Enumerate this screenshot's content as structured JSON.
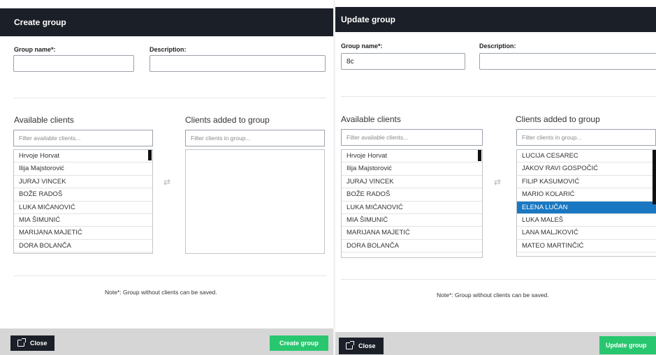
{
  "create": {
    "title": "Create group",
    "group_name_label": "Group name*:",
    "group_name_value": "",
    "description_label": "Description:",
    "description_value": "",
    "available_title": "Available clients",
    "available_filter_placeholder": "Filter available clients...",
    "added_title": "Clients added to group",
    "added_filter_placeholder": "Filter clients in group...",
    "available": [
      "Hrvoje Horvat",
      "Ilija Majstorović",
      "JURAJ VINCEK",
      "BOŽE RADOŠ",
      "LUKA MIĆANOVIĆ",
      "MIA ŠIMUNIĆ",
      "MARIJANA MAJETIĆ",
      "DORA BOLANČA"
    ],
    "added": [],
    "note": "Note*: Group without clients can be saved.",
    "close_label": "Close",
    "submit_label": "Create group"
  },
  "update": {
    "title": "Update group",
    "group_name_label": "Group name*:",
    "group_name_value": "8c",
    "description_label": "Description:",
    "description_value": "",
    "available_title": "Available clients",
    "available_filter_placeholder": "Filter available clients...",
    "added_title": "Clients added to group",
    "added_filter_placeholder": "Filter clients in group...",
    "available": [
      "Hrvoje Horvat",
      "Ilija Majstorović",
      "JURAJ VINCEK",
      "BOŽE RADOŠ",
      "LUKA MIĆANOVIĆ",
      "MIA ŠIMUNIĆ",
      "MARIJANA MAJETIĆ",
      "DORA BOLANČA"
    ],
    "added": [
      "LUCIJA CESAREC",
      "JAKOV RAVI GOSPOČIĆ",
      "FILIP KASUMOVIĆ",
      "MARIO KOLARIĆ",
      "ELENA LUČAN",
      "LUKA MALEŠ",
      "LANA MALJKOVIĆ",
      "MATEO MARTINČIĆ"
    ],
    "selected_added": "ELENA LUČAN",
    "note": "Note*: Group without clients can be saved.",
    "close_label": "Close",
    "submit_label": "Update group"
  },
  "icons": {
    "close": "external-link-icon",
    "swap": "swap-arrows-icon"
  },
  "colors": {
    "header": "#1b1f27",
    "primary_green": "#28c76f",
    "selected": "#1a78c2"
  }
}
